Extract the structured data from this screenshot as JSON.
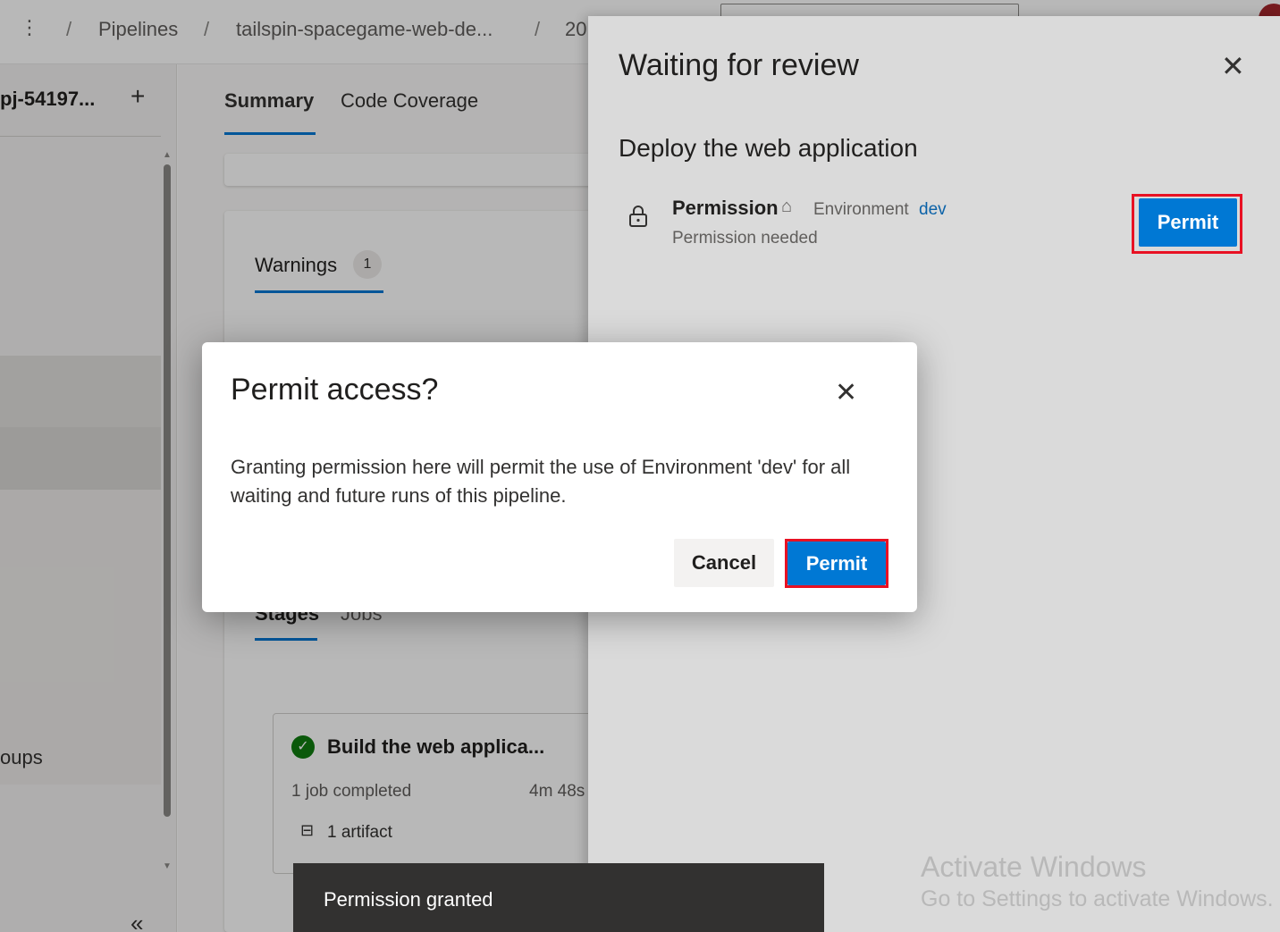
{
  "topbar": {
    "more_glyph": "⋮",
    "sep": "/",
    "breadcrumbs": [
      "Pipelines",
      "tailspin-spacegame-web-de...",
      "20"
    ]
  },
  "leftnav": {
    "project": "pj-54197...",
    "add_glyph": "+",
    "groups_item": "oups",
    "collapse_glyph": "«"
  },
  "main": {
    "tabs": [
      "Summary",
      "Code Coverage"
    ],
    "warnings_label": "Warnings",
    "warnings_count": "1",
    "stages_label": "Stages",
    "jobs_label": "Jobs",
    "stage": {
      "title": "Build the web applica...",
      "jobs_completed": "1 job completed",
      "duration": "4m 48s",
      "artifact": "1 artifact",
      "status_color": "#107c10"
    }
  },
  "panel": {
    "title": "Waiting for review",
    "close_glyph": "✕",
    "subtitle": "Deploy the web application",
    "permission_label": "Permission",
    "environment_label": "Environment",
    "environment_name": "dev",
    "permission_status": "Permission needed",
    "permit_label": "Permit"
  },
  "modal": {
    "title": "Permit access?",
    "close_glyph": "✕",
    "body": "Granting permission here will permit the use of Environment 'dev' for all waiting and future runs of this pipeline.",
    "cancel_label": "Cancel",
    "permit_label": "Permit"
  },
  "toast": {
    "message": "Permission granted"
  },
  "watermark": {
    "line1": "Activate Windows",
    "line2": "Go to Settings to activate Windows."
  },
  "colors": {
    "accent": "#0078d4",
    "highlight_border": "#e81123",
    "link": "#0b62a8"
  },
  "icons": {
    "more": "more-vertical-icon",
    "add": "plus-icon",
    "collapse": "double-chevron-left-icon",
    "close": "close-icon",
    "lock": "lock-icon",
    "environment": "environment-icon",
    "success": "check-circle-icon",
    "artifact": "artifact-icon"
  }
}
